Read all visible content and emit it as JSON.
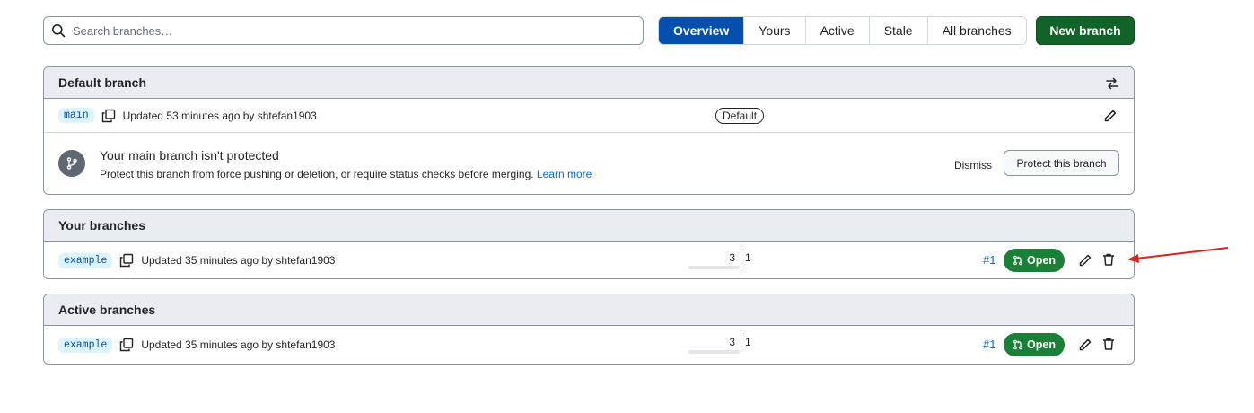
{
  "search": {
    "placeholder": "Search branches…"
  },
  "tabs": [
    {
      "label": "Overview",
      "selected": true
    },
    {
      "label": "Yours",
      "selected": false
    },
    {
      "label": "Active",
      "selected": false
    },
    {
      "label": "Stale",
      "selected": false
    },
    {
      "label": "All branches",
      "selected": false
    }
  ],
  "new_branch_label": "New branch",
  "default_section": {
    "title": "Default branch",
    "branch": {
      "name": "main",
      "updated": "Updated 53 minutes ago by shtefan1903",
      "badge": "Default"
    },
    "protection": {
      "title": "Your main branch isn't protected",
      "description": "Protect this branch from force pushing or deletion, or require status checks before merging.",
      "learn_more": "Learn more",
      "dismiss": "Dismiss",
      "button": "Protect this branch"
    }
  },
  "your_section": {
    "title": "Your branches",
    "branch": {
      "name": "example",
      "updated": "Updated 35 minutes ago by shtefan1903",
      "behind": "3",
      "ahead": "1",
      "pr_number": "#1",
      "pr_status": "Open"
    }
  },
  "active_section": {
    "title": "Active branches",
    "branch": {
      "name": "example",
      "updated": "Updated 35 minutes ago by shtefan1903",
      "behind": "3",
      "ahead": "1",
      "pr_number": "#1",
      "pr_status": "Open"
    }
  },
  "colors": {
    "primary_tab": "#0550ae",
    "new_branch": "#116329",
    "open_badge": "#1a7f37",
    "link": "#0969da",
    "annotation_arrow": "#e0201c"
  }
}
